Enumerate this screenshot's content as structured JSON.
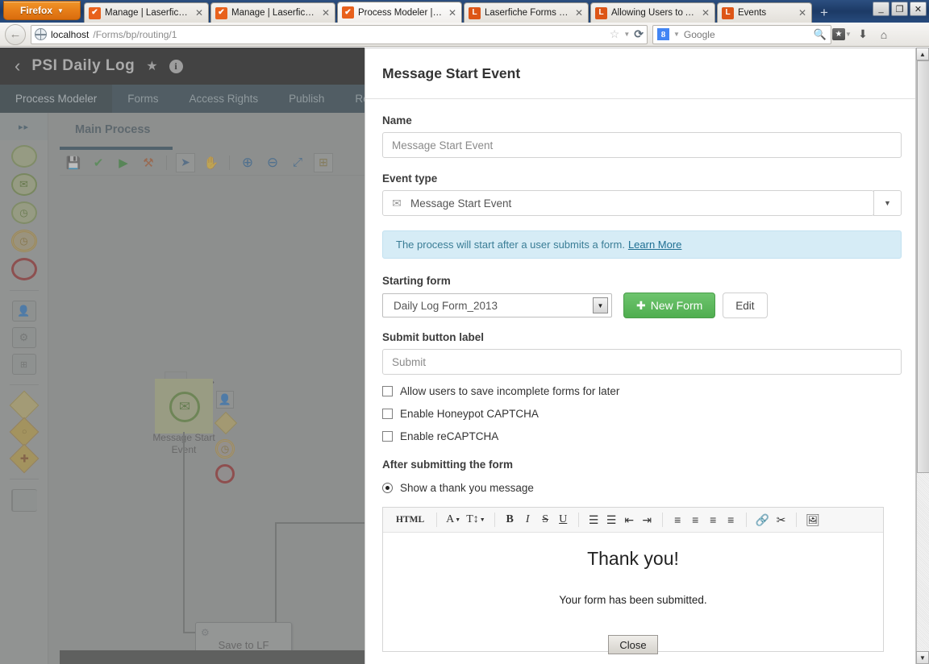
{
  "browser": {
    "app_button": "Firefox",
    "tabs": [
      {
        "favicon": "checkmark-icon",
        "title": "Manage | Laserfiche F...",
        "active": false
      },
      {
        "favicon": "checkmark-icon",
        "title": "Manage | Laserfiche F...",
        "active": false
      },
      {
        "favicon": "checkmark-icon",
        "title": "Process Modeler | Las...",
        "active": true
      },
      {
        "favicon": "laserfiche-icon",
        "title": "Laserfiche Forms Help",
        "active": false
      },
      {
        "favicon": "laserfiche-icon",
        "title": "Allowing Users to Acc...",
        "active": false
      },
      {
        "favicon": "laserfiche-icon",
        "title": "Events",
        "active": false
      }
    ],
    "new_tab_label": "+",
    "window_controls": {
      "minimize": "_",
      "restore": "❐",
      "close": "✕"
    },
    "url_host": "localhost",
    "url_path": "/Forms/bp/routing/1",
    "search_engine": "Google",
    "search_placeholder": "Google",
    "icons": {
      "back": "back-arrow-icon",
      "bookmark_star": "star-icon",
      "reload": "reload-icon",
      "search": "magnifier-icon",
      "bookmarks_menu": "bookmarks-icon",
      "downloads": "download-icon",
      "home": "home-icon"
    }
  },
  "app": {
    "header": {
      "back_label": "‹",
      "title": "PSI Daily Log",
      "star_icon": "star-icon",
      "info_icon": "info-icon"
    },
    "nav": [
      {
        "label": "Process Modeler",
        "active": true
      },
      {
        "label": "Forms",
        "active": false
      },
      {
        "label": "Access Rights",
        "active": false
      },
      {
        "label": "Publish",
        "active": false
      },
      {
        "label": "Results",
        "active": false
      }
    ],
    "canvas": {
      "process_title": "Main Process",
      "toolbar": [
        {
          "name": "save-icon",
          "glyph": "💾"
        },
        {
          "name": "validate-check-icon",
          "glyph": "✔"
        },
        {
          "name": "run-icon",
          "glyph": "▶"
        },
        {
          "name": "tools-icon",
          "glyph": "🛠"
        },
        {
          "name": "pointer-icon",
          "glyph": "➤"
        },
        {
          "name": "hand-pan-icon",
          "glyph": "✋"
        },
        {
          "name": "zoom-in-icon",
          "glyph": "＋"
        },
        {
          "name": "zoom-out-icon",
          "glyph": "－"
        },
        {
          "name": "fit-screen-icon",
          "glyph": "⤢"
        },
        {
          "name": "layout-icon",
          "glyph": "⊞"
        }
      ],
      "nodes": [
        {
          "id": "start",
          "label": "Message Start\nEvent",
          "label_line1": "Message Start",
          "label_line2": "Event",
          "type": "message-start-event"
        },
        {
          "id": "task",
          "label": "Save to LF",
          "type": "service-task"
        }
      ],
      "context_icons": [
        {
          "name": "user-task-icon"
        },
        {
          "name": "gateway-icon"
        },
        {
          "name": "timer-event-icon"
        },
        {
          "name": "end-event-icon"
        }
      ]
    },
    "palette": {
      "expand_label": "▸▸",
      "items": [
        {
          "name": "start-event-icon",
          "glyph": ""
        },
        {
          "name": "message-start-event-icon",
          "glyph": "✉"
        },
        {
          "name": "timer-start-event-icon",
          "glyph": "🕐"
        },
        {
          "name": "intermediate-timer-event-icon",
          "glyph": "🕐"
        },
        {
          "name": "end-event-icon",
          "glyph": ""
        },
        {
          "name": "user-task-icon",
          "glyph": "👤"
        },
        {
          "name": "service-task-icon",
          "glyph": "⚙"
        },
        {
          "name": "subprocess-icon",
          "glyph": "⊞"
        },
        {
          "name": "exclusive-gateway-icon",
          "glyph": ""
        },
        {
          "name": "event-gateway-icon",
          "glyph": "○"
        },
        {
          "name": "parallel-gateway-icon",
          "glyph": "✚"
        },
        {
          "name": "pool-icon",
          "glyph": ""
        }
      ]
    }
  },
  "dialog": {
    "title": "Message Start Event",
    "name_label": "Name",
    "name_value": "Message Start Event",
    "event_type_label": "Event type",
    "event_type_value": "Message Start Event",
    "event_type_icon": "envelope-icon",
    "info_text": "The process will start after a user submits a form.",
    "info_link": "Learn More",
    "starting_form_label": "Starting form",
    "starting_form_value": "Daily Log Form_2013",
    "new_form_button": "New Form",
    "new_form_plus": "✚",
    "edit_button": "Edit",
    "submit_label_label": "Submit button label",
    "submit_label_value": "Submit",
    "checkboxes": [
      {
        "label": "Allow users to save incomplete forms for later",
        "checked": false
      },
      {
        "label": "Enable Honeypot CAPTCHA",
        "checked": false
      },
      {
        "label": "Enable reCAPTCHA",
        "checked": false
      }
    ],
    "after_submit_label": "After submitting the form",
    "radio_options": [
      {
        "label": "Show a thank you message",
        "selected": true
      }
    ],
    "editor": {
      "toolbar": [
        {
          "name": "html-source-button",
          "glyph": "HTML"
        },
        {
          "name": "font-color-button",
          "glyph": "A"
        },
        {
          "name": "font-size-button",
          "glyph": "T↕"
        },
        {
          "name": "bold-button",
          "glyph": "B"
        },
        {
          "name": "italic-button",
          "glyph": "I"
        },
        {
          "name": "strikethrough-button",
          "glyph": "S"
        },
        {
          "name": "underline-button",
          "glyph": "U"
        },
        {
          "name": "bullet-list-button",
          "glyph": "☰"
        },
        {
          "name": "numbered-list-button",
          "glyph": "☰"
        },
        {
          "name": "outdent-button",
          "glyph": "⇤"
        },
        {
          "name": "indent-button",
          "glyph": "⇥"
        },
        {
          "name": "align-left-button",
          "glyph": "≡"
        },
        {
          "name": "align-center-button",
          "glyph": "≡"
        },
        {
          "name": "align-right-button",
          "glyph": "≡"
        },
        {
          "name": "justify-button",
          "glyph": "≡"
        },
        {
          "name": "link-button",
          "glyph": "🔗"
        },
        {
          "name": "unlink-button",
          "glyph": "✂"
        },
        {
          "name": "image-button",
          "glyph": "🖼"
        }
      ],
      "content_heading": "Thank you!",
      "content_text": "Your form has been submitted.",
      "close_button": "Close"
    }
  },
  "scrollbar": {
    "up_arrow": "▲",
    "down_arrow": "▼"
  },
  "colors": {
    "accent_green": "#5cb85c",
    "nav_dark": "#1e3845",
    "info_blue": "#d6ecf6",
    "link_blue": "#1f6f93"
  }
}
